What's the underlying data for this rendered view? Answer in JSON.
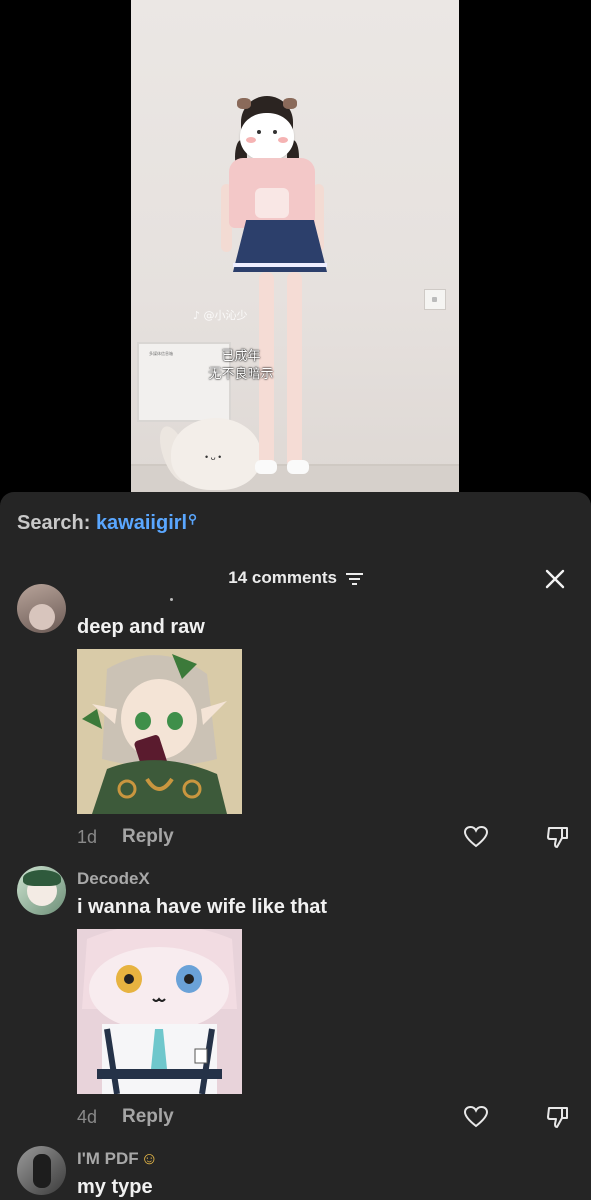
{
  "video": {
    "watermark": "@小沁少",
    "subtitle_line1": "已成年",
    "subtitle_line2": "无不良暗示",
    "panel_label": "多媒体信息箱"
  },
  "search": {
    "prefix": "Search:",
    "term": "kawaiigirl"
  },
  "comments_panel": {
    "count_label": "14 comments",
    "icons": {
      "sort": "filter-lines-icon",
      "close": "close-x-icon"
    }
  },
  "comments": [
    {
      "username": "",
      "text": "deep and raw",
      "time": "1d",
      "reply_label": "Reply",
      "image": "anime-girl-holding-phone"
    },
    {
      "username": "DecodeX",
      "text": "i wanna have wife like that",
      "time": "4d",
      "reply_label": "Reply",
      "image": "anime-plush-figure"
    },
    {
      "username": "I'M PDF",
      "username_emoji": "☺",
      "text": "my type"
    }
  ],
  "colors": {
    "sheet_bg": "#252525",
    "search_term": "#5aa7ff",
    "username": "#a8a8a8",
    "comment_text": "#f1f1f1"
  }
}
